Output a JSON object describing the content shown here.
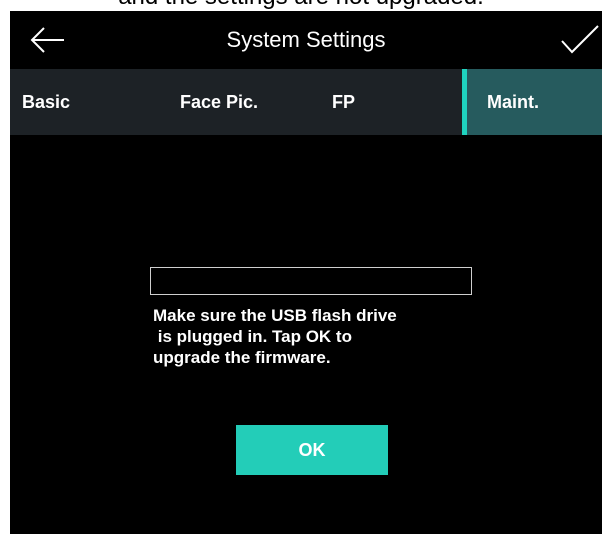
{
  "top_fragment": "and the settings are not upgraded.",
  "title_bar": {
    "title": "System Settings",
    "back_icon": "arrow-left-icon",
    "confirm_icon": "checkmark-icon"
  },
  "tabs": [
    {
      "label": "Basic"
    },
    {
      "label": "Face Pic."
    },
    {
      "label": "FP"
    },
    {
      "label": "Maint.",
      "selected": true
    }
  ],
  "upgrade": {
    "progress": 0,
    "message": "Make sure the USB flash drive\n is plugged in. Tap OK to\nupgrade the firmware.",
    "ok_label": "OK"
  },
  "colors": {
    "accent": "#1fd3bf",
    "selected_tab_bg": "#265b5e",
    "tab_bar_bg": "#1d2226",
    "screen_bg": "#000000",
    "ok_button_bg": "#23cdb8"
  }
}
